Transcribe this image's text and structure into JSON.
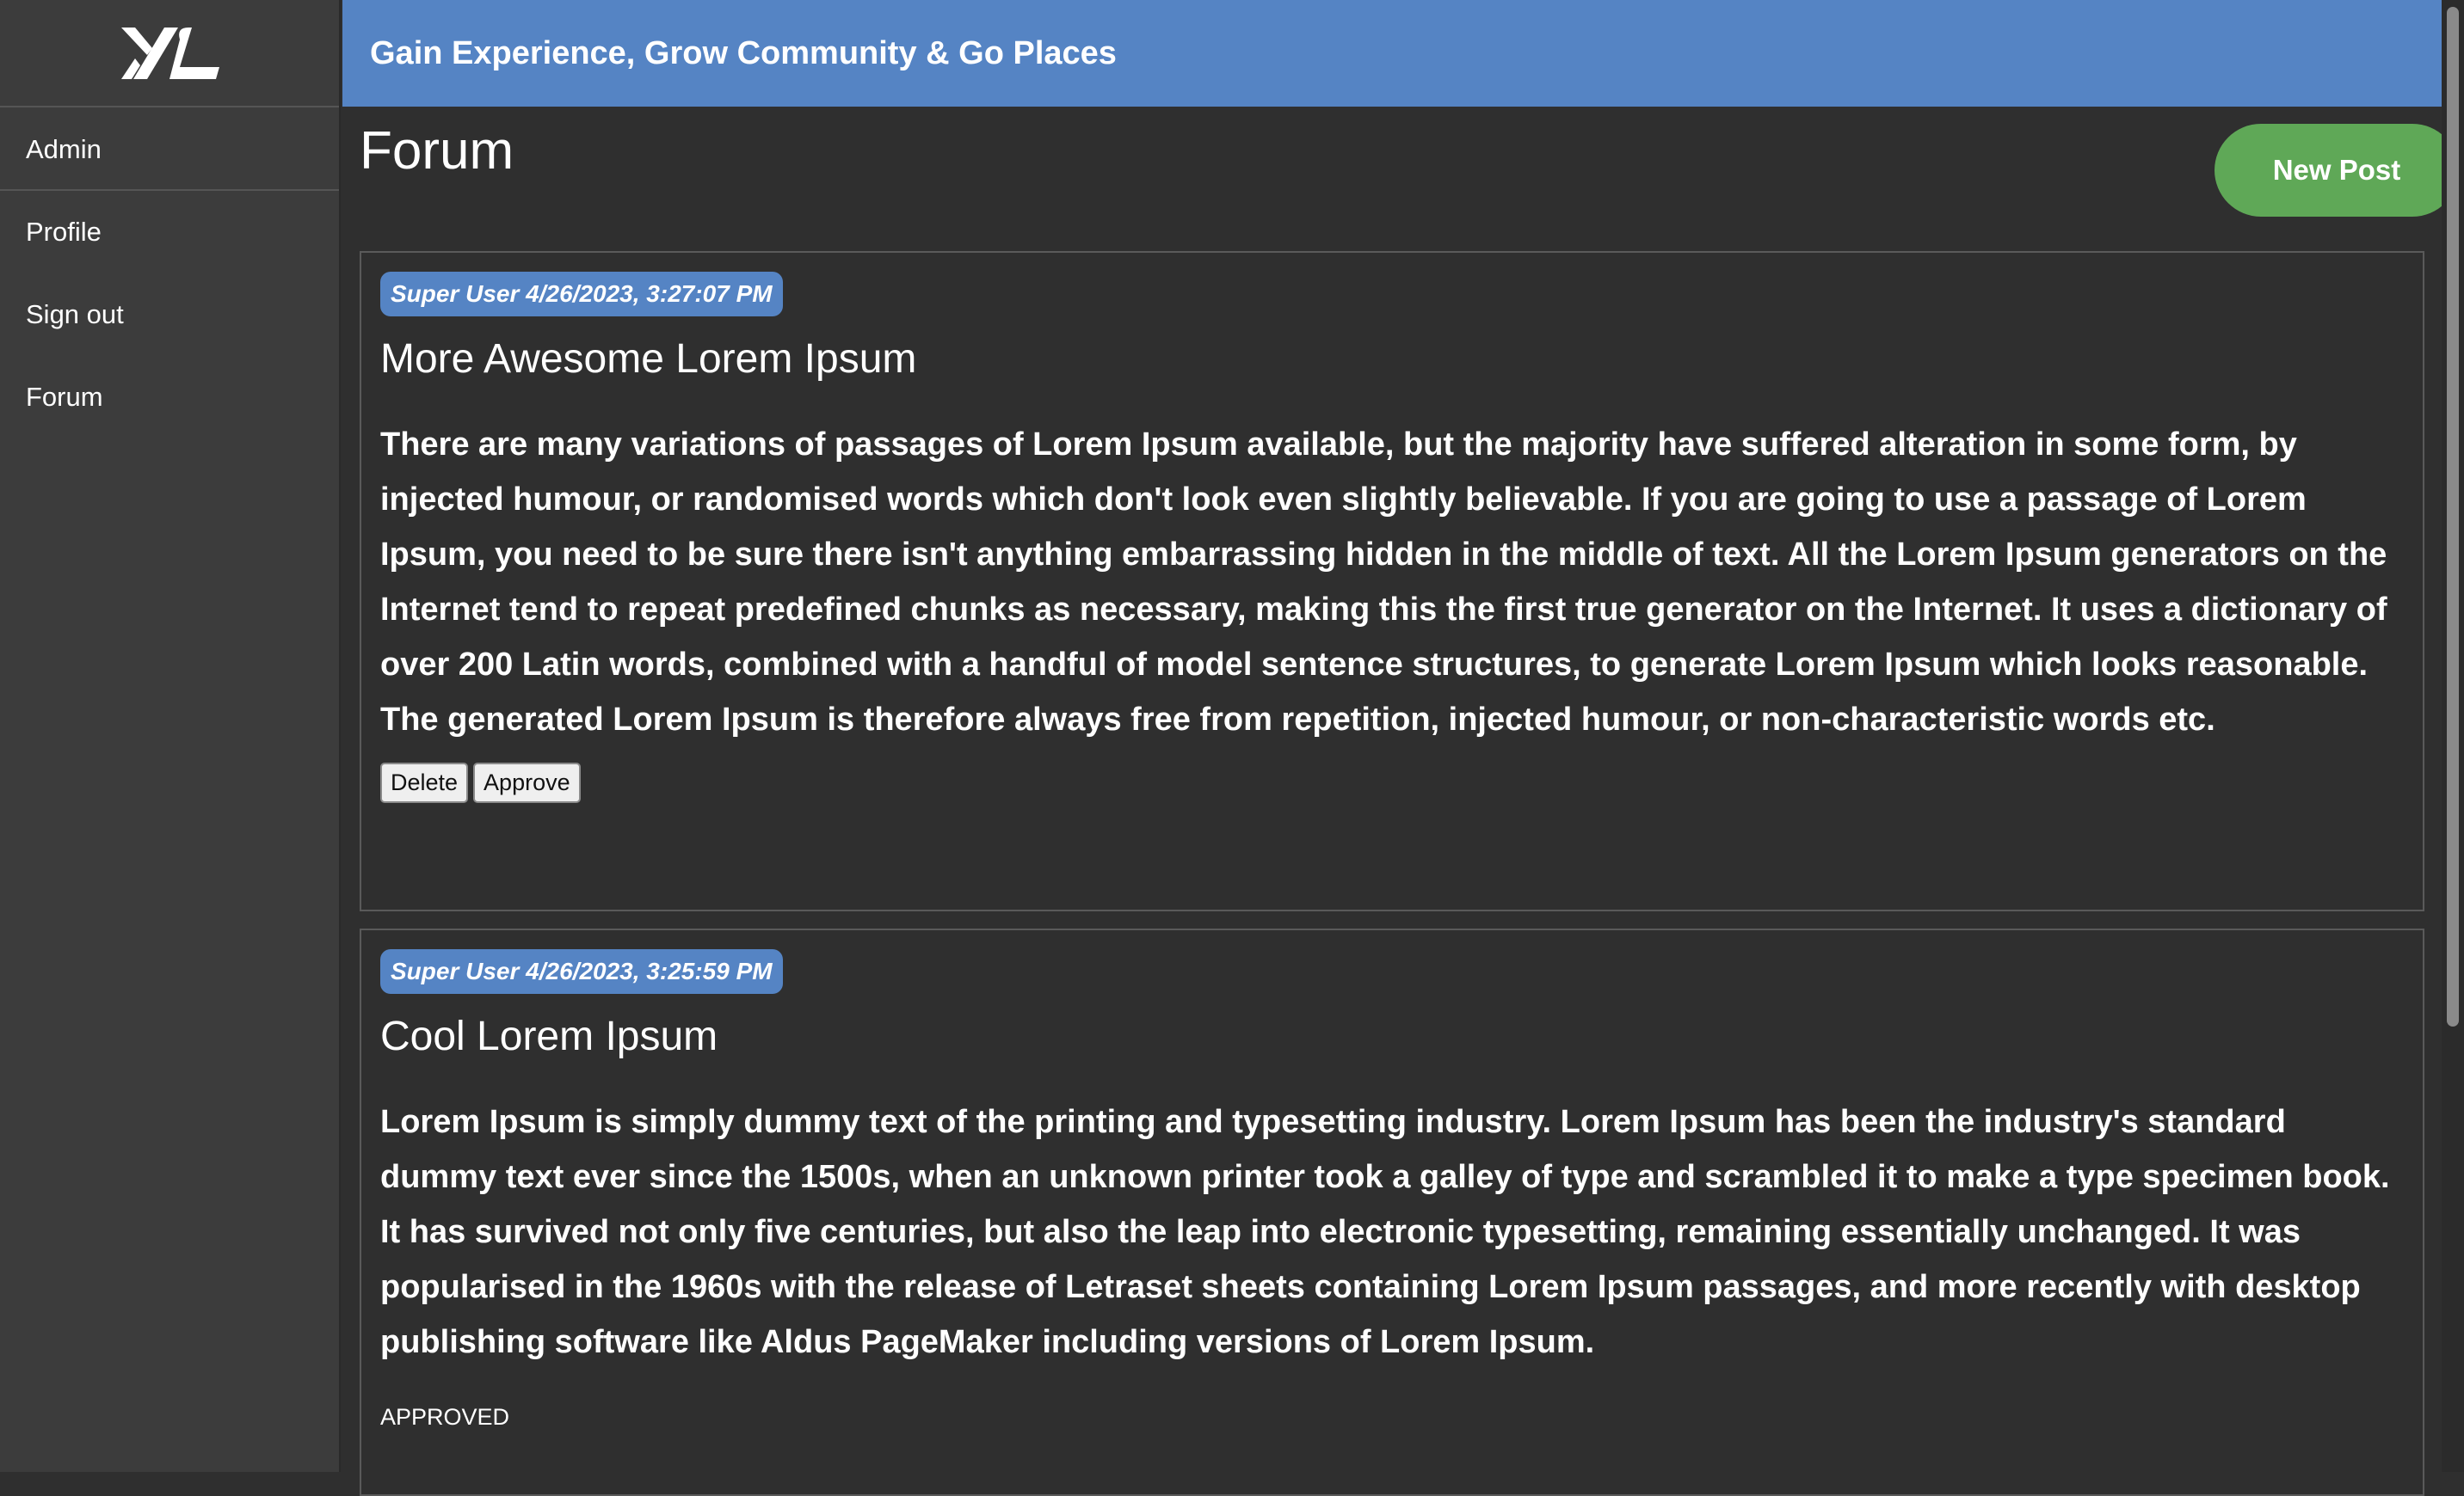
{
  "sidebar": {
    "logo_text": "XL",
    "items": [
      {
        "label": "Admin"
      },
      {
        "label": "Profile"
      },
      {
        "label": "Sign out"
      },
      {
        "label": "Forum"
      }
    ]
  },
  "header": {
    "title": "Gain Experience, Grow Community & Go Places"
  },
  "main": {
    "page_title": "Forum",
    "new_post_label": "New Post"
  },
  "posts": [
    {
      "meta": "Super User 4/26/2023, 3:27:07 PM",
      "title": "More Awesome Lorem Ipsum",
      "body": "There are many variations of passages of Lorem Ipsum available, but the majority have suffered alteration in some form, by injected humour, or randomised words which don't look even slightly believable. If you are going to use a passage of Lorem Ipsum, you need to be sure there isn't anything embarrassing hidden in the middle of text. All the Lorem Ipsum generators on the Internet tend to repeat predefined chunks as necessary, making this the first true generator on the Internet. It uses a dictionary of over 200 Latin words, combined with a handful of model sentence structures, to generate Lorem Ipsum which looks reasonable. The generated Lorem Ipsum is therefore always free from repetition, injected humour, or non-characteristic words etc.",
      "delete_label": "Delete",
      "approve_label": "Approve"
    },
    {
      "meta": "Super User 4/26/2023, 3:25:59 PM",
      "title": "Cool Lorem Ipsum",
      "body": "Lorem Ipsum is simply dummy text of the printing and typesetting industry. Lorem Ipsum has been the industry's standard dummy text ever since the 1500s, when an unknown printer took a galley of type and scrambled it to make a type specimen book. It has survived not only five centuries, but also the leap into electronic typesetting, remaining essentially unchanged. It was popularised in the 1960s with the release of Letraset sheets containing Lorem Ipsum passages, and more recently with desktop publishing software like Aldus PageMaker including versions of Lorem Ipsum.",
      "status": "APPROVED"
    }
  ],
  "colors": {
    "header_bg": "#5584c4",
    "sidebar_bg": "#3c3c3c",
    "main_bg": "#2f2f2f",
    "new_post_bg": "#5fa857",
    "badge_bg": "#5584c4"
  }
}
